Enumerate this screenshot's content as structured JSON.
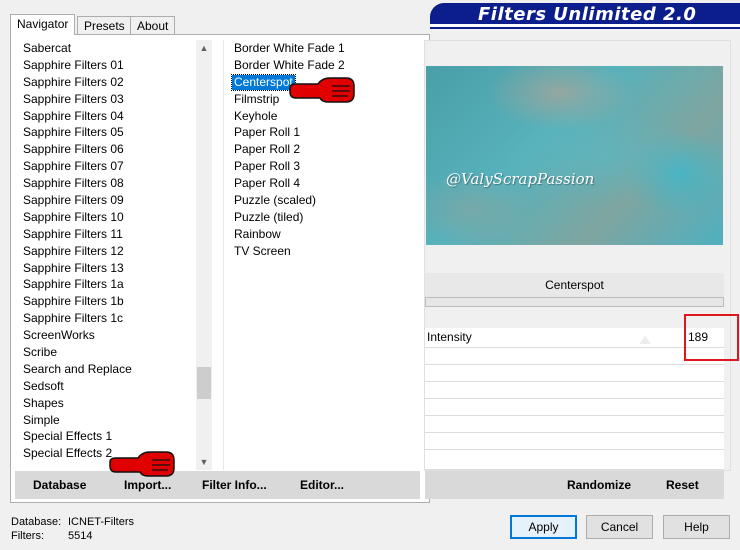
{
  "tabs": [
    "Navigator",
    "Presets",
    "About"
  ],
  "banner_title": "Filters Unlimited 2.0",
  "categories": [
    "Sabercat",
    "Sapphire Filters 01",
    "Sapphire Filters 02",
    "Sapphire Filters 03",
    "Sapphire Filters 04",
    "Sapphire Filters 05",
    "Sapphire Filters 06",
    "Sapphire Filters 07",
    "Sapphire Filters 08",
    "Sapphire Filters 09",
    "Sapphire Filters 10",
    "Sapphire Filters 11",
    "Sapphire Filters 12",
    "Sapphire Filters 13",
    "Sapphire Filters 1a",
    "Sapphire Filters 1b",
    "Sapphire Filters 1c",
    "ScreenWorks",
    "Scribe",
    "Search and Replace",
    "Sedsoft",
    "Shapes",
    "Simple",
    "Special Effects 1",
    "Special Effects 2"
  ],
  "filters": [
    "Border White Fade 1",
    "Border White Fade 2",
    "Centerspot",
    "Filmstrip",
    "Keyhole",
    "Paper Roll 1",
    "Paper Roll 2",
    "Paper Roll 3",
    "Paper Roll 4",
    "Puzzle (scaled)",
    "Puzzle (tiled)",
    "Rainbow",
    "TV Screen"
  ],
  "selected_filter": "Centerspot",
  "left_buttons": {
    "database": "Database",
    "import": "Import...",
    "filter_info": "Filter Info...",
    "editor": "Editor..."
  },
  "preview_watermark": "@ValyScrapPassion",
  "filter_name": "Centerspot",
  "param": {
    "label": "Intensity",
    "value": "189"
  },
  "right_buttons": {
    "randomize": "Randomize",
    "reset": "Reset"
  },
  "footer": {
    "database_label": "Database:",
    "database_value": "ICNET-Filters",
    "filters_label": "Filters:",
    "filters_value": "5514"
  },
  "dialog_buttons": {
    "apply": "Apply",
    "cancel": "Cancel",
    "help": "Help"
  },
  "colors": {
    "banner": "#0c1d8c",
    "selection": "#0078d7",
    "highlight": "#e0161e",
    "hand": "#e00000"
  }
}
